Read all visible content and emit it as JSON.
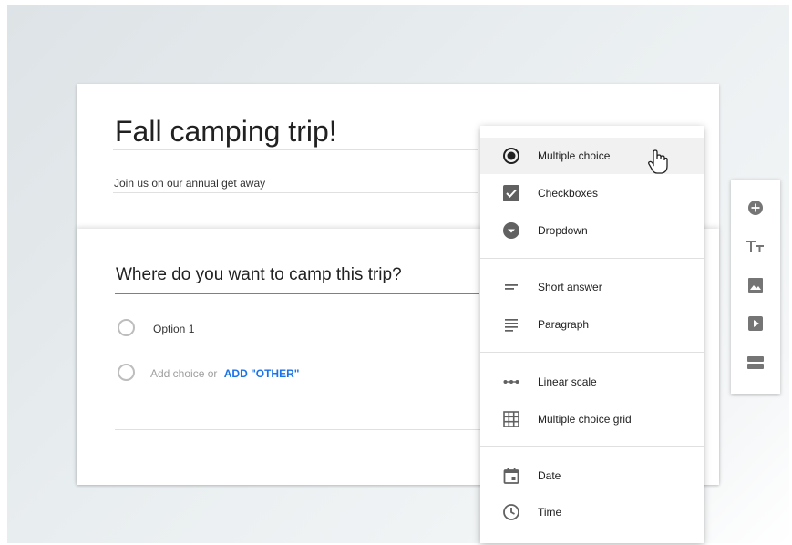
{
  "form": {
    "title": "Fall camping trip!",
    "description": "Join us on our annual get away"
  },
  "question": {
    "text": "Where do you want to camp this trip?",
    "options": [
      "Option 1"
    ],
    "add_choice_text": "Add choice or",
    "add_other_label": "ADD \"OTHER\""
  },
  "menu": {
    "items": [
      {
        "label": "Multiple choice",
        "icon": "radio-button-icon",
        "selected": true
      },
      {
        "label": "Checkboxes",
        "icon": "checkbox-icon"
      },
      {
        "label": "Dropdown",
        "icon": "dropdown-icon"
      },
      {
        "label": "Short answer",
        "icon": "short-answer-icon"
      },
      {
        "label": "Paragraph",
        "icon": "paragraph-icon"
      },
      {
        "label": "Linear scale",
        "icon": "linear-scale-icon"
      },
      {
        "label": "Multiple choice grid",
        "icon": "grid-icon"
      },
      {
        "label": "Date",
        "icon": "calendar-icon"
      },
      {
        "label": "Time",
        "icon": "clock-icon"
      }
    ]
  },
  "toolbar": {
    "buttons": [
      {
        "icon": "add-question-icon"
      },
      {
        "icon": "title-text-icon"
      },
      {
        "icon": "image-icon"
      },
      {
        "icon": "video-icon"
      },
      {
        "icon": "section-icon"
      }
    ]
  },
  "colors": {
    "accent": "#1a73e8",
    "icon_gray": "#616161",
    "toolbar_icon": "#757575",
    "underline": "#6b8790"
  }
}
